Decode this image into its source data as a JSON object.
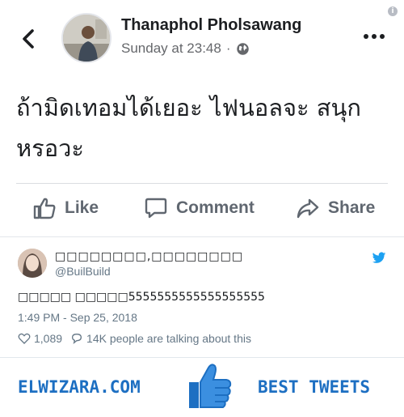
{
  "facebook_post": {
    "author": "Thanaphol Pholsawang",
    "timestamp": "Sunday at 23:48",
    "separator": "·",
    "privacy_icon": "globe-icon",
    "text": "ถ้ามิดเทอมได้เยอะ ไฟนอลจะ สนุกหรอวะ",
    "actions": {
      "like": "Like",
      "comment": "Comment",
      "share": "Share"
    },
    "info_glyph": "i"
  },
  "tweet": {
    "display_name": "□□□□□□□□,□□□□□□□□",
    "handle": "@BuilBuild",
    "text": "□□□□□ □□□□□5555555555555555555",
    "time": "1:49 PM - Sep 25, 2018",
    "likes": "1,089",
    "talking": "14K people are talking about this",
    "bird_color": "#1da1f2"
  },
  "footer": {
    "left_brand": "ELWIZARA.COM",
    "right_brand": "BEST TWEETS",
    "accent": "#1d6fc2"
  }
}
